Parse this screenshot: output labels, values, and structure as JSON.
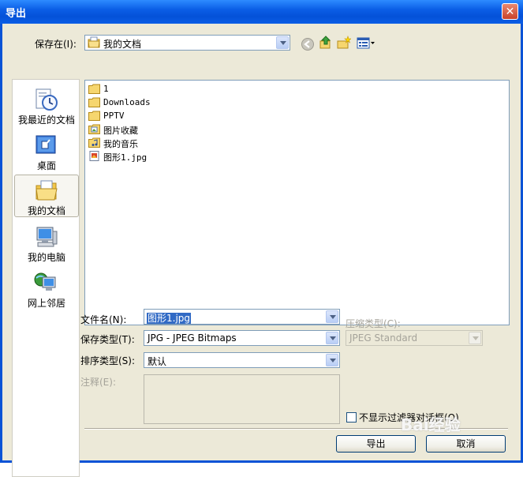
{
  "window": {
    "title": "导出",
    "close_label": "✕"
  },
  "save_in": {
    "label": "保存在(I):",
    "value": "我的文档"
  },
  "toolbar": {
    "back_icon": "back-arrow-icon",
    "up_icon": "up-folder-icon",
    "new_folder_icon": "new-folder-icon",
    "views_icon": "views-menu-icon"
  },
  "places": [
    {
      "label": "我最近的文档",
      "icon": "recent-documents-icon"
    },
    {
      "label": "桌面",
      "icon": "desktop-icon"
    },
    {
      "label": "我的文档",
      "icon": "my-documents-icon"
    },
    {
      "label": "我的电脑",
      "icon": "my-computer-icon"
    },
    {
      "label": "网上邻居",
      "icon": "network-places-icon"
    }
  ],
  "files": [
    {
      "name": "1",
      "icon": "folder-icon"
    },
    {
      "name": "Downloads",
      "icon": "folder-icon"
    },
    {
      "name": "PPTV",
      "icon": "folder-icon"
    },
    {
      "name": "图片收藏",
      "icon": "pictures-folder-icon"
    },
    {
      "name": "我的音乐",
      "icon": "music-folder-icon"
    },
    {
      "name": "图形1.jpg",
      "icon": "jpg-file-icon"
    }
  ],
  "form": {
    "filename_label": "文件名(N):",
    "filename_value": "图形1.jpg",
    "savetype_label": "保存类型(T):",
    "savetype_value": "JPG - JPEG Bitmaps",
    "sorttype_label": "排序类型(S):",
    "sorttype_value": "默认",
    "comment_label": "注释(E):",
    "compression_label": "压缩类型(C):",
    "compression_value": "JPEG Standard",
    "no_filter_dialog_label": "不显示过滤器对话框(O)"
  },
  "buttons": {
    "export": "导出",
    "cancel": "取消"
  },
  "watermark": "Bai经验"
}
